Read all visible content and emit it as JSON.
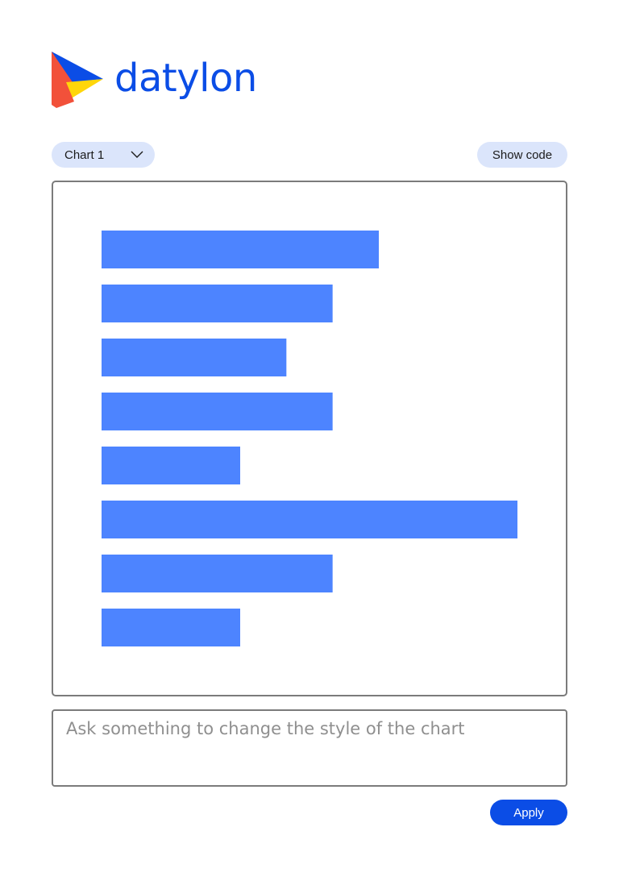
{
  "brand": {
    "name": "datylon",
    "logo_icon": "datylon-logo-icon",
    "color": "#0b4de6"
  },
  "toolbar": {
    "chart_select_value": "Chart 1",
    "show_code_label": "Show code"
  },
  "prompt": {
    "placeholder": "Ask something to change the style of the chart",
    "value": ""
  },
  "actions": {
    "apply_label": "Apply"
  },
  "colors": {
    "accent": "#0b4de6",
    "pill_background": "#dbe5fb",
    "bar": "#4d84ff",
    "border": "#7b7b7b"
  },
  "chart_data": {
    "type": "bar",
    "orientation": "horizontal",
    "categories": [],
    "values": [
      6,
      5,
      4,
      5,
      3,
      9,
      5,
      3
    ],
    "xlim": [
      0,
      9
    ],
    "grid": false,
    "legend": "none",
    "color": "#4d84ff"
  }
}
